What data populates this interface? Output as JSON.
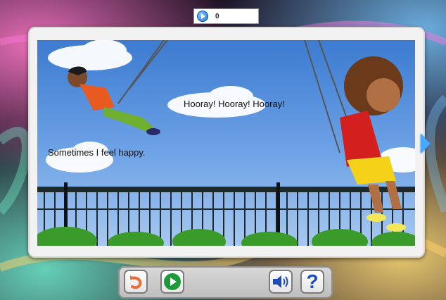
{
  "header": {
    "score_value": "0",
    "score_icon": "play-circle-icon"
  },
  "page": {
    "text_left": "Sometimes I feel happy.",
    "text_right": "Hooray! Hooray! Hooray!"
  },
  "navigation": {
    "next_icon": "next-page-arrow-icon"
  },
  "toolbar": {
    "back_icon": "undo-arrow-icon",
    "play_icon": "play-icon",
    "sound_icon": "speaker-icon",
    "help_icon": "help-icon",
    "help_glyph": "?"
  },
  "colors": {
    "accent_blue": "#1e4db7",
    "play_green": "#1f9a3a",
    "back_orange": "#f06a3a"
  }
}
